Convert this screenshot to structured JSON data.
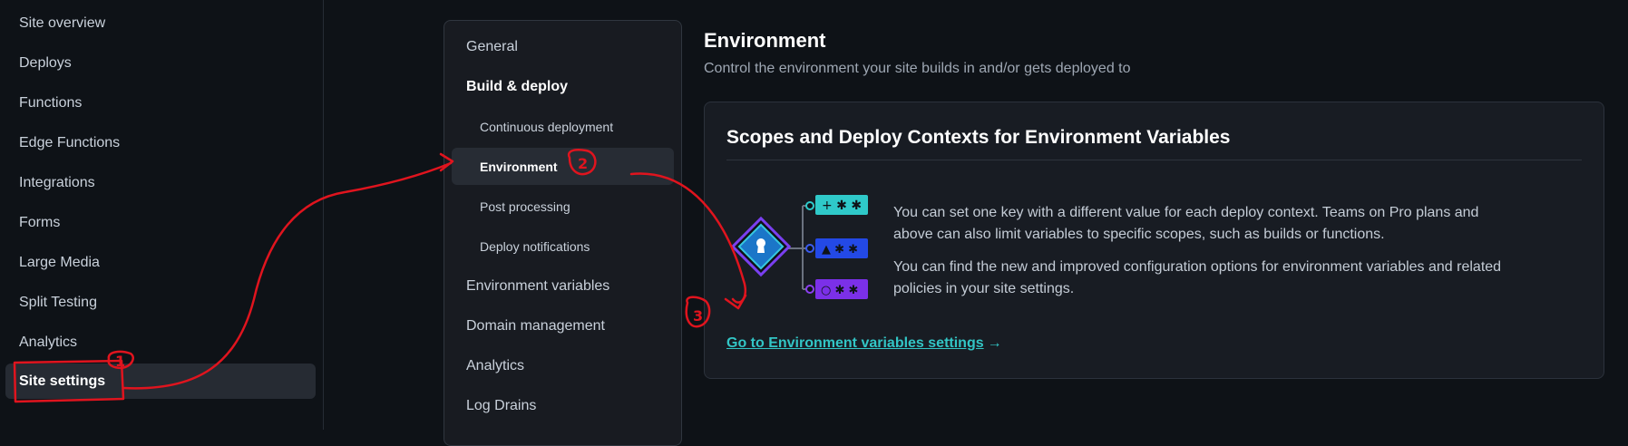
{
  "sidebar": {
    "items": [
      {
        "label": "Site overview",
        "active": false
      },
      {
        "label": "Deploys",
        "active": false
      },
      {
        "label": "Functions",
        "active": false
      },
      {
        "label": "Edge Functions",
        "active": false
      },
      {
        "label": "Integrations",
        "active": false
      },
      {
        "label": "Forms",
        "active": false
      },
      {
        "label": "Large Media",
        "active": false
      },
      {
        "label": "Split Testing",
        "active": false
      },
      {
        "label": "Analytics",
        "active": false
      },
      {
        "label": "Site settings",
        "active": true
      }
    ]
  },
  "subnav": {
    "items": [
      {
        "label": "General"
      },
      {
        "label": "Build & deploy"
      },
      {
        "label": "Continuous deployment"
      },
      {
        "label": "Environment"
      },
      {
        "label": "Post processing"
      },
      {
        "label": "Deploy notifications"
      },
      {
        "label": "Environment variables"
      },
      {
        "label": "Domain management"
      },
      {
        "label": "Analytics"
      },
      {
        "label": "Log Drains"
      }
    ]
  },
  "main": {
    "title": "Environment",
    "description": "Control the environment your site builds in and/or gets deployed to",
    "card": {
      "title": "Scopes and Deploy Contexts for Environment Variables",
      "paragraph1": "You can set one key with a different value for each deploy context. Teams on Pro plans and above can also limit variables to specific scopes, such as builds or functions.",
      "paragraph2": "You can find the new and improved configuration options for environment variables and related policies in your site settings.",
      "link_label": "Go to Environment variables settings",
      "link_arrow": "→"
    }
  },
  "annotations": {
    "markers": [
      "1",
      "2",
      "3"
    ]
  },
  "colors": {
    "background": "#0e1217",
    "accent_teal": "#32c5c5",
    "annotation_red": "#e0141e"
  }
}
